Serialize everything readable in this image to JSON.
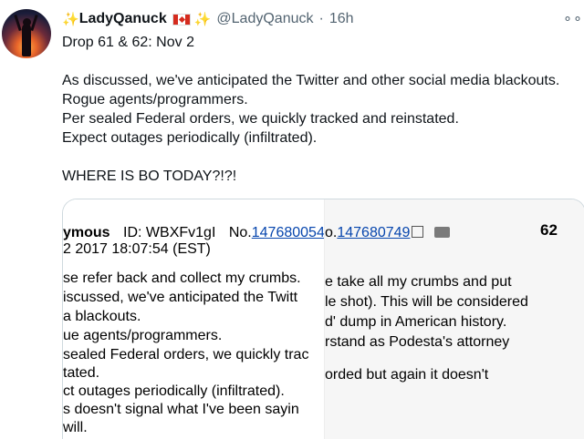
{
  "tweet": {
    "display_name": "LadyQanuck",
    "handle": "@LadyQanuck",
    "separator": "·",
    "time": "16h",
    "more": "∘∘∘",
    "star_left": "✨",
    "star_right": "✨",
    "flag_icon": "canada-flag-icon",
    "lines": [
      "Drop 61 & 62: Nov 2",
      "",
      "As discussed, we've anticipated the Twitter and other social media blackouts.",
      "Rogue agents/programmers.",
      "Per sealed Federal orders, we quickly tracked and reinstated.",
      "Expect outages periodically (infiltrated).",
      "",
      "WHERE IS BO TODAY?!?!"
    ]
  },
  "post_left": {
    "header_author": "ymous",
    "header_id": "ID: WBXFv1gI",
    "header_no_label": "No.",
    "header_no": "147680054",
    "date": "2 2017 18:07:54 (EST)",
    "lines": [
      "se refer back and collect my crumbs.",
      "iscussed, we've anticipated the Twitt",
      "a blackouts.",
      "ue agents/programmers.",
      "sealed Federal orders, we quickly trac",
      "tated.",
      "ct outages periodically (infiltrated).",
      "s doesn't signal what I've been sayin",
      " will."
    ]
  },
  "post_right": {
    "header_no_prefix": "o.",
    "header_no": "147680749",
    "number": "62",
    "lines": [
      "e take all my crumbs and put",
      "le shot). This will be considered",
      "d' dump in American history.",
      "rstand as Podesta's attorney",
      "",
      "orded but again it doesn't"
    ]
  },
  "colors": {
    "text": "#0f1419",
    "muted": "#536471",
    "link": "#0645ad",
    "star": "#f5b400"
  }
}
